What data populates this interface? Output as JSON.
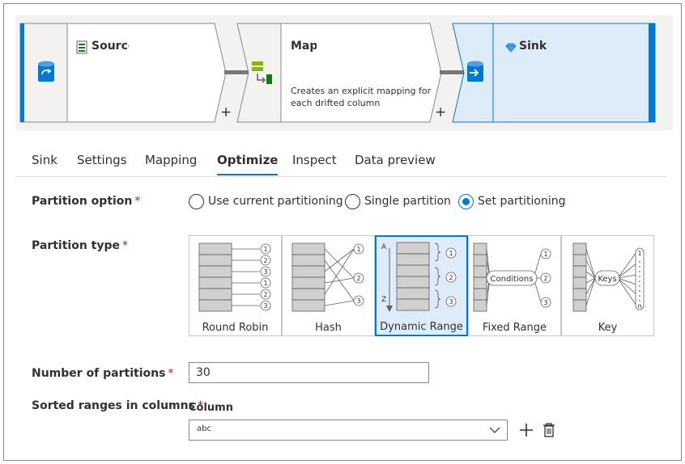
{
  "flow": {
    "source_title": "Source",
    "map_title": "Map",
    "map_description_line1": "Creates an explicit mapping for",
    "map_description_line2": "each drifted column",
    "sink_title": "Sink",
    "add_symbol": "+"
  },
  "tabs": [
    {
      "label": "Sink"
    },
    {
      "label": "Settings"
    },
    {
      "label": "Mapping"
    },
    {
      "label": "Optimize",
      "active": true
    },
    {
      "label": "Inspect"
    },
    {
      "label": "Data preview"
    }
  ],
  "partition_option": {
    "label": "Partition option",
    "required_mark": "*",
    "options": [
      "Use current partitioning",
      "Single partition",
      "Set partitioning"
    ],
    "selected": "Set partitioning"
  },
  "partition_type": {
    "label": "Partition type",
    "required_mark": "*",
    "tiles": [
      "Round Robin",
      "Hash",
      "Dynamic Range",
      "Fixed Range",
      "Key"
    ],
    "selected": "Dynamic Range",
    "diagram_text": {
      "conditions": "Conditions",
      "keys": "Keys",
      "range_start": "A",
      "range_end": "Z",
      "numbers": [
        "1",
        "2",
        "3"
      ],
      "last_key": "n"
    }
  },
  "number_of_partitions": {
    "label": "Number of partitions",
    "required_mark": "*",
    "value": "30"
  },
  "sorted_ranges": {
    "label": "Sorted ranges in columns",
    "required_mark": "*",
    "column_header": "Column",
    "column_value": "abc"
  },
  "colors": {
    "accent": "#0078d4",
    "selected_fill": "#deecf9",
    "required": "#a4262c"
  }
}
